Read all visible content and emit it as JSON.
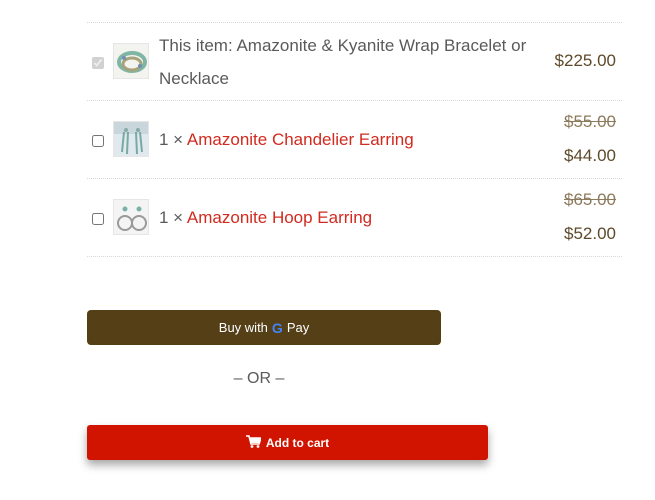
{
  "bundle": {
    "items": [
      {
        "name_line1": "This item: Amazonite & Kyanite Wrap Bracelet or",
        "name_line2": "Necklace",
        "price": "$225.00",
        "checked": true,
        "disabled": true
      },
      {
        "qty": "1 ×",
        "link": "Amazonite Chandelier Earring",
        "old_price": "$55.00",
        "price": "$44.00",
        "checked": false
      },
      {
        "qty": "1 ×",
        "link": "Amazonite Hoop Earring",
        "old_price": "$65.00",
        "price": "$52.00",
        "checked": false
      }
    ]
  },
  "gpay": {
    "label": "Buy with",
    "brand": "Pay"
  },
  "or_text": "– OR –",
  "cart": {
    "label": "Add to cart",
    "icon": "cart-icon"
  },
  "colors": {
    "link": "#d12a1f",
    "price": "#5e4a2a",
    "gpay_bg": "#543f17",
    "cart_bg": "#d11400"
  }
}
